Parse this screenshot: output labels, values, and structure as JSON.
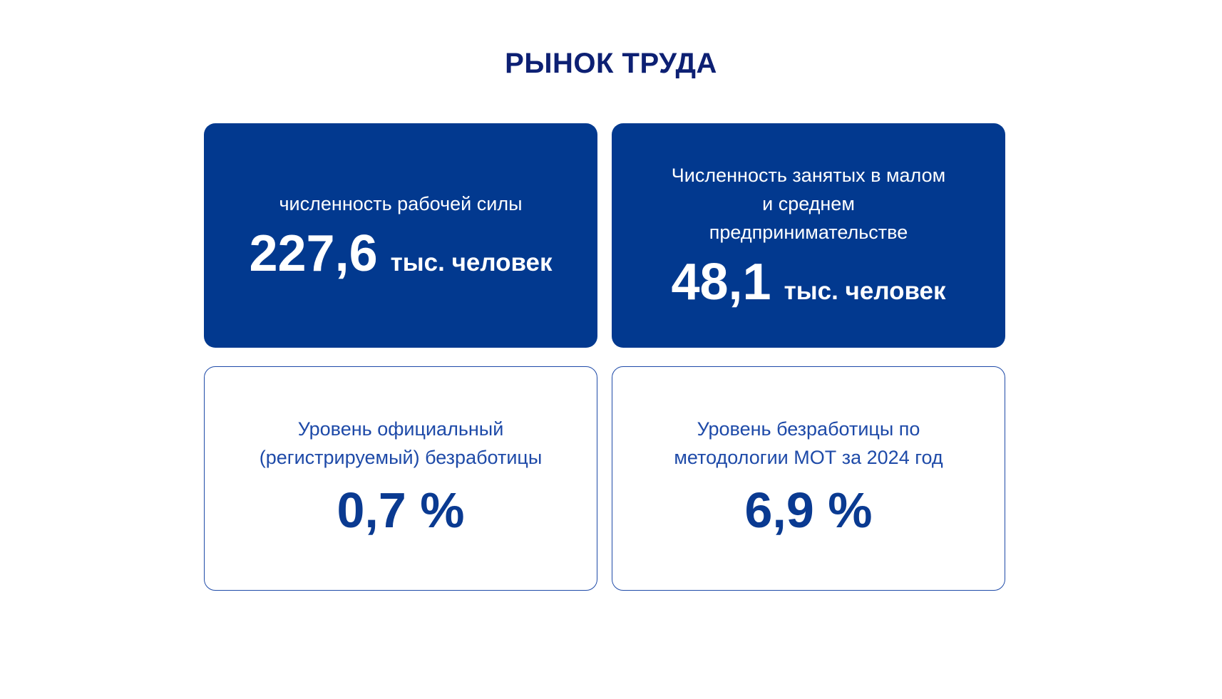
{
  "title": "РЫНОК ТРУДА",
  "cards": [
    {
      "label": "численность рабочей силы",
      "value": "227,6",
      "unit": "тыс. человек"
    },
    {
      "label_lines": [
        "Численность занятых в малом",
        "и среднем",
        "предпринимательстве"
      ],
      "value": "48,1",
      "unit": "тыс. человек"
    },
    {
      "label_lines": [
        "Уровень официальный",
        "(регистрируемый) безработицы"
      ],
      "value": "0,7 %"
    },
    {
      "label_lines": [
        "Уровень безработицы по",
        "методологии МОТ за 2024 год"
      ],
      "value": "6,9 %"
    }
  ],
  "colors": {
    "title": "#0d2073",
    "filled_card_bg": "#02398f",
    "outline_border": "#1e4aa8",
    "outline_text": "#0a3a91"
  }
}
